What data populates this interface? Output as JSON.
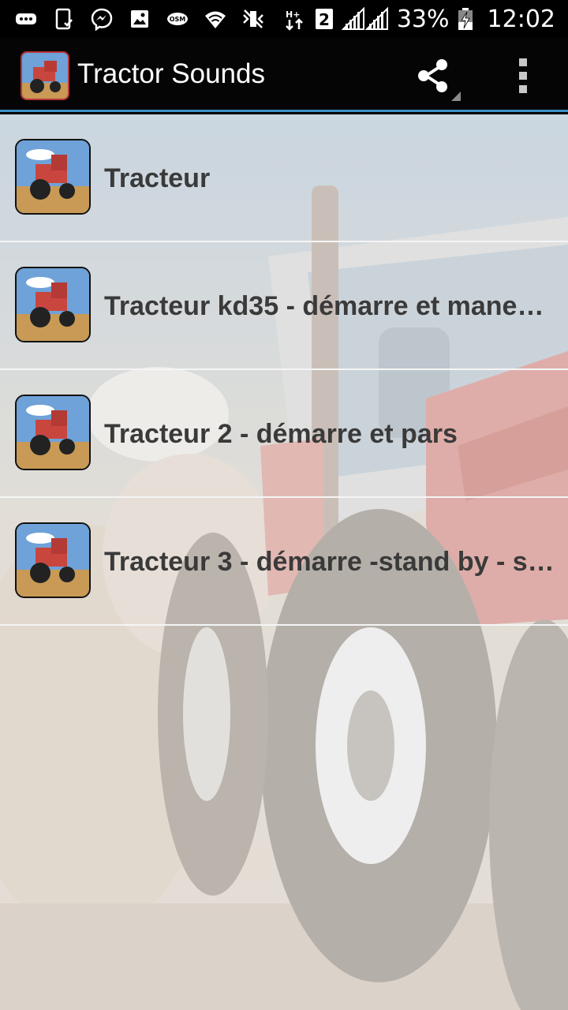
{
  "status_bar": {
    "battery_percent": "33%",
    "sim_slot": "2",
    "time": "12:02",
    "icons": [
      "more-notifications-icon",
      "phone-check-icon",
      "messenger-icon",
      "gallery-icon",
      "osm-icon",
      "wifi-icon",
      "mute-icon",
      "data-arrows-icon",
      "sim-2-icon",
      "signal-icon",
      "battery-charging-icon"
    ]
  },
  "action_bar": {
    "title": "Tractor Sounds",
    "share_icon": "share-icon",
    "overflow_icon": "overflow-menu-icon"
  },
  "sounds": {
    "items": [
      {
        "label": "Tracteur"
      },
      {
        "label": "Tracteur kd35 - démarre et mane…"
      },
      {
        "label": "Tracteur 2 - démarre et pars"
      },
      {
        "label": "Tracteur 3 - démarre -stand by - s…"
      }
    ]
  },
  "colors": {
    "accent_line": "#3b90c6",
    "action_bar_bg": "#050505",
    "label_text": "#3a3a3a",
    "tractor_red": "#c9463f"
  }
}
